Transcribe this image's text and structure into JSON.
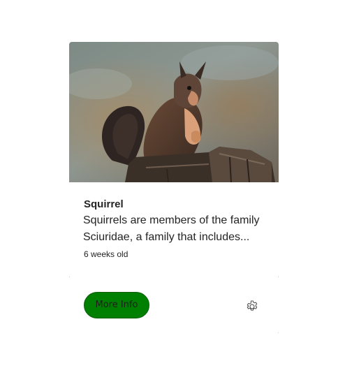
{
  "card": {
    "image_alt": "Squirrel",
    "title": "Squirrel",
    "description": "Squirrels are members of the family Sciuridae, a family that includes...",
    "age": "6 weeks old",
    "more_info_label": "More Info",
    "settings_icon": "gear-icon"
  },
  "colors": {
    "button_bg": "#008000",
    "text": "#242424"
  }
}
